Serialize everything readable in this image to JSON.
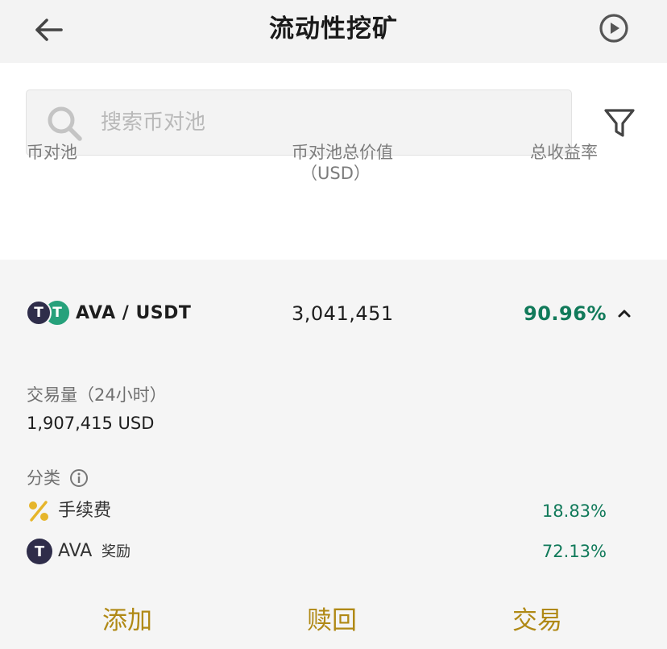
{
  "header": {
    "title": "流动性挖矿",
    "back_icon": "arrow-left-icon",
    "play_icon": "play-circle-icon"
  },
  "search": {
    "placeholder": "搜索币对池",
    "value": "",
    "icon": "search-icon",
    "filter_icon": "filter-icon"
  },
  "table": {
    "columns": {
      "pair": "币对池",
      "tvl": "币对池总价值",
      "tvl_unit": "（USD）",
      "apr": "总收益率"
    }
  },
  "pool": {
    "name": "AVA / USDT",
    "tvl": "3,041,451",
    "apr": "90.96%",
    "coin_icons": [
      "ava-coin-icon",
      "usdt-coin-icon"
    ],
    "coin_glyph": "T",
    "collapse_icon": "chevron-up-icon",
    "details": {
      "volume_label": "交易量（24小时）",
      "volume_value": "1,907,415 USD",
      "category_label": "分类",
      "category_info_icon": "info-icon",
      "fee": {
        "label": "手续费",
        "value": "18.83%",
        "icon": "percent-icon"
      },
      "reward": {
        "token": "AVA",
        "suffix": "奖励",
        "value": "72.13%",
        "icon": "ava-coin-icon"
      }
    }
  },
  "actions": {
    "add": "添加",
    "redeem": "赎回",
    "trade": "交易"
  },
  "colors": {
    "accent": "#b08915",
    "positive": "#117a5a",
    "ava": "#2f2d4a",
    "usdt": "#26a17b"
  }
}
